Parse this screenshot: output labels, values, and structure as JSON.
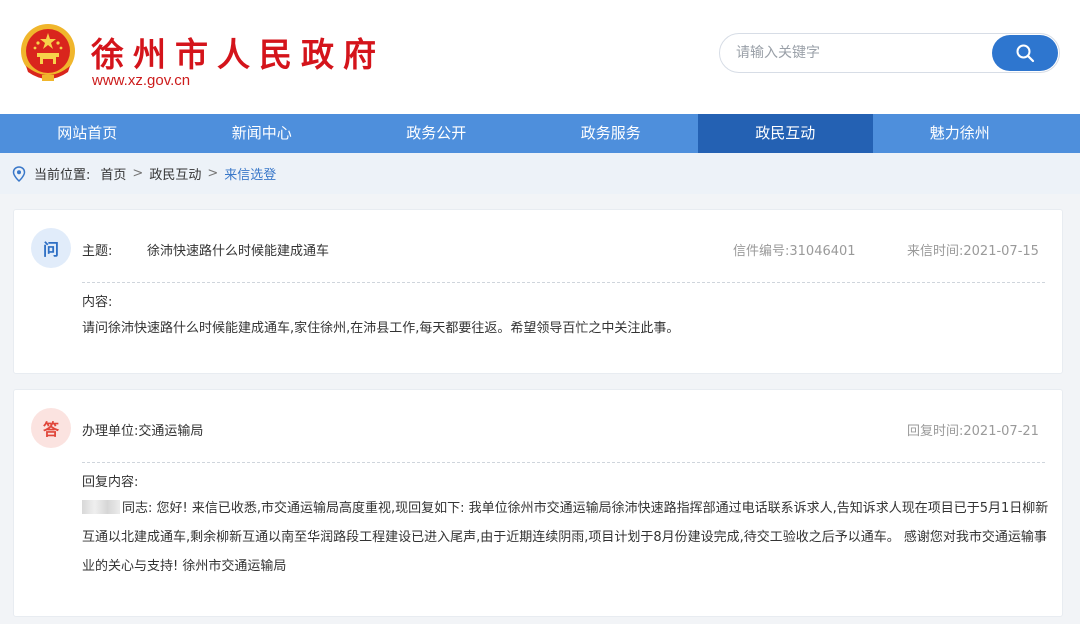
{
  "header": {
    "site_title": "徐州市人民政府",
    "site_url": "www.xz.gov.cn",
    "search_placeholder": "请输入关键字"
  },
  "nav": {
    "items": [
      "网站首页",
      "新闻中心",
      "政务公开",
      "政务服务",
      "政民互动",
      "魅力徐州"
    ],
    "active": "政民互动"
  },
  "breadcrumb": {
    "label": "当前位置:",
    "items": [
      "首页",
      "政民互动",
      "来信选登"
    ]
  },
  "question": {
    "badge": "问",
    "subject_label": "主题:",
    "subject": "徐沛快速路什么时候能建成通车",
    "letter_no": "信件编号:31046401",
    "sent_time": "来信时间:2021-07-15",
    "content_label": "内容:",
    "content": "请问徐沛快速路什么时候能建成通车,家住徐州,在沛县工作,每天都要往返。希望领导百忙之中关注此事。"
  },
  "answer": {
    "badge": "答",
    "unit": "办理单位:交通运输局",
    "reply_time": "回复时间:2021-07-21",
    "content_label": "回复内容:",
    "content": "同志: 您好! 来信已收悉,市交通运输局高度重视,现回复如下: 我单位徐州市交通运输局徐沛快速路指挥部通过电话联系诉求人,告知诉求人现在项目已于5月1日柳新互通以北建成通车,剩余柳新互通以南至华润路段工程建设已进入尾声,由于近期连续阴雨,项目计划于8月份建设完成,待交工验收之后予以通车。 感谢您对我市交通运输事业的关心与支持! 徐州市交通运输局"
  },
  "colors": {
    "brand_red": "#d4141b",
    "nav_blue": "#4e8fdc",
    "nav_active": "#2461b3",
    "search_blue": "#2e76cf"
  },
  "icons": [
    "national-emblem-icon",
    "search-icon",
    "location-pin-icon"
  ]
}
